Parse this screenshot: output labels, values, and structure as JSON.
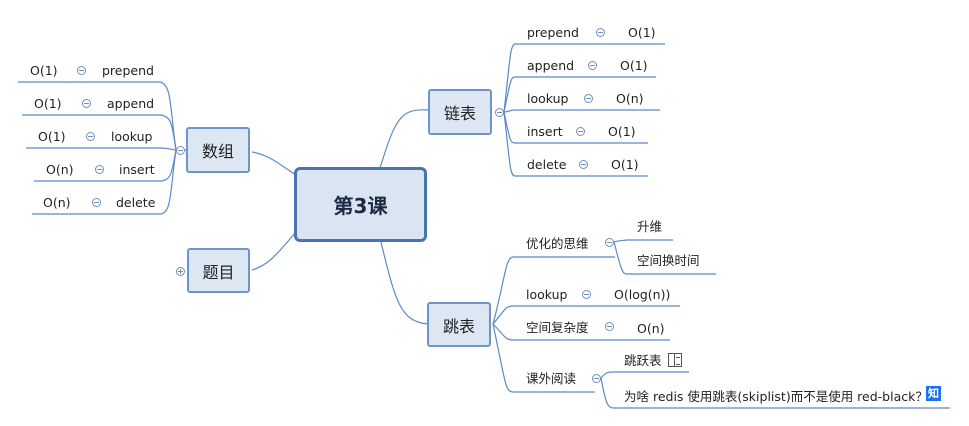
{
  "center": {
    "label": "第3课"
  },
  "array": {
    "label": "数组",
    "rows": [
      {
        "op": "prepend",
        "cost": "O(1)"
      },
      {
        "op": "append",
        "cost": "O(1)"
      },
      {
        "op": "lookup",
        "cost": "O(1)"
      },
      {
        "op": "insert",
        "cost": "O(n)"
      },
      {
        "op": "delete",
        "cost": "O(n)"
      }
    ]
  },
  "problems": {
    "label": "题目"
  },
  "linked_list": {
    "label": "链表",
    "rows": [
      {
        "op": "prepend",
        "cost": "O(1)"
      },
      {
        "op": "append",
        "cost": "O(1)"
      },
      {
        "op": "lookup",
        "cost": "O(n)"
      },
      {
        "op": "insert",
        "cost": "O(1)"
      },
      {
        "op": "delete",
        "cost": "O(1)"
      }
    ]
  },
  "skip_list": {
    "label": "跳表",
    "optimization": {
      "label": "优化的思维",
      "items": [
        "升维",
        "空间换时间"
      ]
    },
    "lookup": {
      "label": "lookup",
      "value": "O(log(n))"
    },
    "space": {
      "label": "空间复杂度",
      "value": "O(n)"
    },
    "reading": {
      "label": "课外阅读",
      "items": [
        {
          "text": "跳跃表",
          "icon": "book-icon"
        },
        {
          "text": "为啥 redis 使用跳表(skiplist)而不是使用 red-black？",
          "icon": "zhihu-icon"
        }
      ]
    }
  },
  "colors": {
    "line": "#5b8bc7",
    "node_fill": "#dde6f3",
    "node_border": "#6f95c6",
    "center_border": "#4a74b1",
    "zhihu": "#1772f6"
  }
}
